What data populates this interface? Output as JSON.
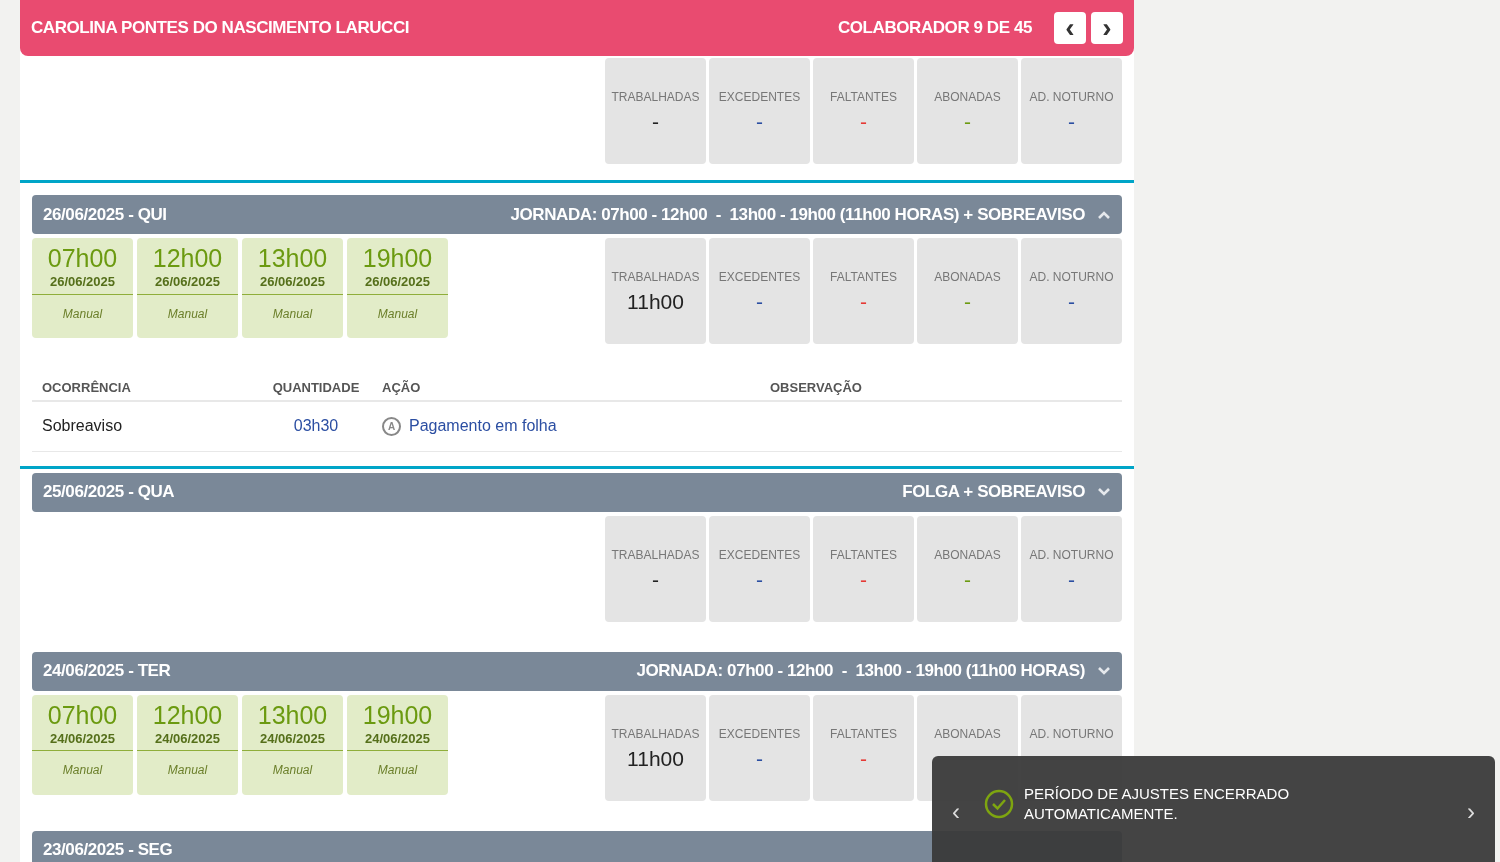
{
  "header": {
    "name": "CAROLINA PONTES DO NASCIMENTO LARUCCI",
    "counter": "COLABORADOR 9 DE 45",
    "prev": "‹",
    "next": "›"
  },
  "days": [
    {
      "stats": [
        {
          "label": "TRABALHADAS",
          "value": "-",
          "color": "#222222"
        },
        {
          "label": "EXCEDENTES",
          "value": "-",
          "color": "#2b4ea2"
        },
        {
          "label": "FALTANTES",
          "value": "-",
          "color": "#e53935"
        },
        {
          "label": "ABONADAS",
          "value": "-",
          "color": "#6b9a10"
        },
        {
          "label": "AD. NOTURNO",
          "value": "-",
          "color": "#2b4ea2"
        }
      ]
    },
    {
      "date": "26/06/2025 - QUI",
      "schedule": "JORNADA: 07h00 - 12h00  -  13h00 - 19h00 (11h00 HORAS) + SOBREAVISO",
      "selected": true,
      "expanded": true,
      "punches": [
        {
          "time": "07h00",
          "date": "26/06/2025",
          "note": "Manual"
        },
        {
          "time": "12h00",
          "date": "26/06/2025",
          "note": "Manual"
        },
        {
          "time": "13h00",
          "date": "26/06/2025",
          "note": "Manual"
        },
        {
          "time": "19h00",
          "date": "26/06/2025",
          "note": "Manual"
        }
      ],
      "stats": [
        {
          "label": "TRABALHADAS",
          "value": "11h00",
          "color": "#222222"
        },
        {
          "label": "EXCEDENTES",
          "value": "-",
          "color": "#2b4ea2"
        },
        {
          "label": "FALTANTES",
          "value": "-",
          "color": "#e53935"
        },
        {
          "label": "ABONADAS",
          "value": "-",
          "color": "#6b9a10"
        },
        {
          "label": "AD. NOTURNO",
          "value": "-",
          "color": "#2b4ea2"
        }
      ],
      "occurrences": {
        "columns": [
          "OCORRÊNCIA",
          "QUANTIDADE",
          "AÇÃO",
          "OBSERVAÇÃO"
        ],
        "rows": [
          {
            "ocorrencia": "Sobreaviso",
            "quantidade": "03h30",
            "acao_icon": "A",
            "acao": "Pagamento em folha"
          }
        ]
      }
    },
    {
      "date": "25/06/2025 - QUA",
      "schedule": "FOLGA + SOBREAVISO",
      "selected": false,
      "expanded": false,
      "stats": [
        {
          "label": "TRABALHADAS",
          "value": "-",
          "color": "#222222"
        },
        {
          "label": "EXCEDENTES",
          "value": "-",
          "color": "#2b4ea2"
        },
        {
          "label": "FALTANTES",
          "value": "-",
          "color": "#e53935"
        },
        {
          "label": "ABONADAS",
          "value": "-",
          "color": "#6b9a10"
        },
        {
          "label": "AD. NOTURNO",
          "value": "-",
          "color": "#2b4ea2"
        }
      ]
    },
    {
      "date": "24/06/2025 - TER",
      "schedule": "JORNADA: 07h00 - 12h00  -  13h00 - 19h00 (11h00 HORAS)",
      "selected": false,
      "expanded": false,
      "punches": [
        {
          "time": "07h00",
          "date": "24/06/2025",
          "note": "Manual"
        },
        {
          "time": "12h00",
          "date": "24/06/2025",
          "note": "Manual"
        },
        {
          "time": "13h00",
          "date": "24/06/2025",
          "note": "Manual"
        },
        {
          "time": "19h00",
          "date": "24/06/2025",
          "note": "Manual"
        }
      ],
      "stats": [
        {
          "label": "TRABALHADAS",
          "value": "11h00",
          "color": "#222222"
        },
        {
          "label": "EXCEDENTES",
          "value": "-",
          "color": "#2b4ea2"
        },
        {
          "label": "FALTANTES",
          "value": "-",
          "color": "#e53935"
        },
        {
          "label": "ABONADAS"
        },
        {
          "label": "AD. NOTURNO"
        }
      ]
    },
    {
      "date": "23/06/2025 - SEG",
      "selected": false
    }
  ],
  "toast": {
    "message": "PERÍODO DE AJUSTES ENCERRADO AUTOMATICAMENTE.",
    "prev": "‹",
    "next": "›"
  }
}
